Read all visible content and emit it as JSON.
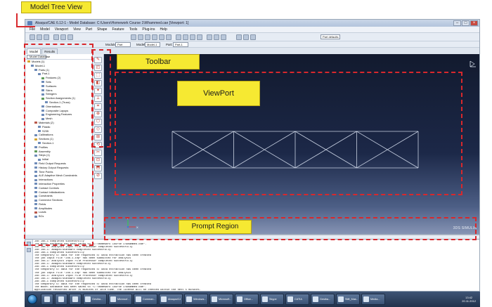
{
  "window": {
    "title": "Abaqus/CAE 6.12-1 - Model Database: C:\\Users\\Homework Course 1\\Whammed.cae [Viewport: 1]"
  },
  "menubar": {
    "items": [
      "File",
      "Model",
      "Viewport",
      "View",
      "Part",
      "Shape",
      "Feature",
      "Tools",
      "Plug-ins",
      "Help"
    ]
  },
  "toolbar2": {
    "module_label": "Module:",
    "module_value": "Part",
    "model_label": "Model:",
    "model_value": "Model-1",
    "part_label": "Part:",
    "part_value": "Part-1",
    "defaults_value": "Part defaults"
  },
  "tabs": [
    "Model",
    "Results"
  ],
  "tree": {
    "header": "Model Database",
    "items": [
      {
        "label": "Models (1)",
        "level": 0,
        "icon": "y"
      },
      {
        "label": "Model-1",
        "level": 1,
        "icon": "b"
      },
      {
        "label": "Parts (1)",
        "level": 2,
        "icon": "b"
      },
      {
        "label": "Part-1",
        "level": 3,
        "icon": "b"
      },
      {
        "label": "Features (2)",
        "level": 4,
        "icon": "g"
      },
      {
        "label": "Sets",
        "level": 4,
        "icon": "b"
      },
      {
        "label": "Surfaces",
        "level": 4,
        "icon": "b"
      },
      {
        "label": "Skins",
        "level": 4,
        "icon": "b"
      },
      {
        "label": "Stringers",
        "level": 4,
        "icon": "b"
      },
      {
        "label": "Section Assignments (1)",
        "level": 4,
        "icon": "g"
      },
      {
        "label": "Section-1 (Truss)",
        "level": 5,
        "icon": "b"
      },
      {
        "label": "Orientations",
        "level": 4,
        "icon": "b"
      },
      {
        "label": "Composite Layups",
        "level": 4,
        "icon": "b"
      },
      {
        "label": "Engineering Features",
        "level": 4,
        "icon": "b"
      },
      {
        "label": "Mesh",
        "level": 4,
        "icon": "b"
      },
      {
        "label": "Materials (2)",
        "level": 2,
        "icon": "r"
      },
      {
        "label": "Plastic",
        "level": 3,
        "icon": "b"
      },
      {
        "label": "S235",
        "level": 3,
        "icon": "b"
      },
      {
        "label": "Calibrations",
        "level": 2,
        "icon": "b"
      },
      {
        "label": "Sections (1)",
        "level": 2,
        "icon": "y"
      },
      {
        "label": "Section-1",
        "level": 3,
        "icon": "b"
      },
      {
        "label": "Profiles",
        "level": 2,
        "icon": "b"
      },
      {
        "label": "Assembly",
        "level": 2,
        "icon": "g"
      },
      {
        "label": "Steps (1)",
        "level": 2,
        "icon": "b"
      },
      {
        "label": "Initial",
        "level": 3,
        "icon": "b"
      },
      {
        "label": "Field Output Requests",
        "level": 2,
        "icon": "b"
      },
      {
        "label": "History Output Requests",
        "level": 2,
        "icon": "b"
      },
      {
        "label": "Time Points",
        "level": 2,
        "icon": "b"
      },
      {
        "label": "ALE Adaptive Mesh Constraints",
        "level": 2,
        "icon": "b"
      },
      {
        "label": "Interactions",
        "level": 2,
        "icon": "b"
      },
      {
        "label": "Interaction Properties",
        "level": 2,
        "icon": "b"
      },
      {
        "label": "Contact Controls",
        "level": 2,
        "icon": "b"
      },
      {
        "label": "Contact Initializations",
        "level": 2,
        "icon": "b"
      },
      {
        "label": "Constraints",
        "level": 2,
        "icon": "b"
      },
      {
        "label": "Connector Sections",
        "level": 2,
        "icon": "b"
      },
      {
        "label": "Fields",
        "level": 2,
        "icon": "b"
      },
      {
        "label": "Amplitudes",
        "level": 2,
        "icon": "b"
      },
      {
        "label": "Loads",
        "level": 2,
        "icon": "r"
      },
      {
        "label": "BCs",
        "level": 2,
        "icon": "b"
      }
    ]
  },
  "viewport": {
    "logo": "3DS SIMULIA"
  },
  "messages": [
    "Job Job-1 completed successfully",
    "The model database has been saved to \"C:\\Homework Course 1\\Whammed.cae\".",
    "Job Job-1: Analysis Input File Processor completed successfully",
    "Job Job-1: Abaqus/Standard completed successfully",
    "Job Job-1 completed successfully",
    "The temporary ST data for the requested ST data extraction has been created",
    "The job input file \"Job-1.inp\" has been submitted for analysis",
    "Job Job-1: Analysis Input File Processor completed successfully",
    "Job Job-1: Abaqus/Standard completed successfully",
    "Job Job-1 completed successfully",
    "The temporary ST data for the requested ST data extraction has been created",
    "The job input file \"Job-1.inp\" has been submitted for analysis",
    "Job Job-1: Analysis Input File Processor completed successfully",
    "Job Job-1: Abaqus/Standard completed successfully",
    "Job Job-1 completed successfully",
    "The temporary ST data for the requested ST data extraction has been created",
    "The model database has been saved to \"C:\\Homework Course 1\\Whammed.cae\".",
    "Application restarted after 75 minutes of idle time. The license will be checked within the next 5 minutes."
  ],
  "taskbar": {
    "pinned": [
      "ie-icon",
      "explorer-icon",
      "word-icon"
    ],
    "tasks": [
      "Gesiba...",
      "Microsof...",
      "Comman...",
      "Abaqus/CAE",
      "Windows...",
      "Microsoft...",
      "Office...",
      "Skype",
      "CATIA",
      "Gesiba...",
      "Stift_Mas...",
      "Media..."
    ],
    "clock": "13:42",
    "date": "20.11.2012"
  },
  "annotations": {
    "model_tree": "Model Tree View",
    "toolbar": "Toolbar",
    "viewport": "ViewPort",
    "prompt": "Prompt Region",
    "color": "#d8282c",
    "callout_color": "#f6e932"
  }
}
